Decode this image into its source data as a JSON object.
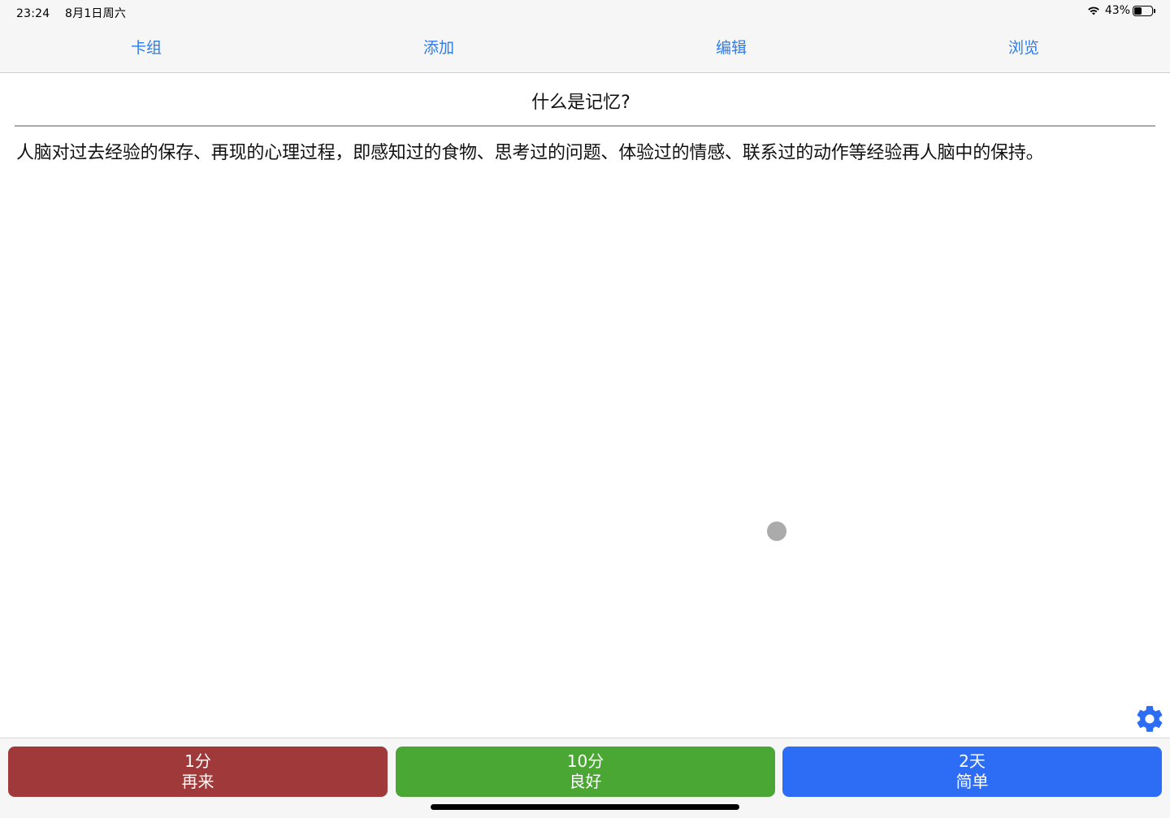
{
  "status_bar": {
    "time": "23:24",
    "date": "8月1日周六",
    "battery_percent": "43%",
    "battery_level": 0.43
  },
  "toolbar": {
    "items": [
      {
        "label": "卡组"
      },
      {
        "label": "添加"
      },
      {
        "label": "编辑"
      },
      {
        "label": "浏览"
      }
    ]
  },
  "card": {
    "question": "什么是记忆?",
    "answer": "人脑对过去经验的保存、再现的心理过程，即感知过的食物、思考过的问题、体验过的情感、联系过的动作等经验再人脑中的保持。"
  },
  "answer_buttons": [
    {
      "interval": "1分",
      "label": "再来",
      "color": "#a03a3a"
    },
    {
      "interval": "10分",
      "label": "良好",
      "color": "#4ba733"
    },
    {
      "interval": "2天",
      "label": "简单",
      "color": "#2d6df5"
    }
  ],
  "icons": {
    "settings": "gear-icon",
    "wifi": "wifi-icon",
    "battery": "battery-icon"
  },
  "colors": {
    "accent": "#2f7bea"
  }
}
